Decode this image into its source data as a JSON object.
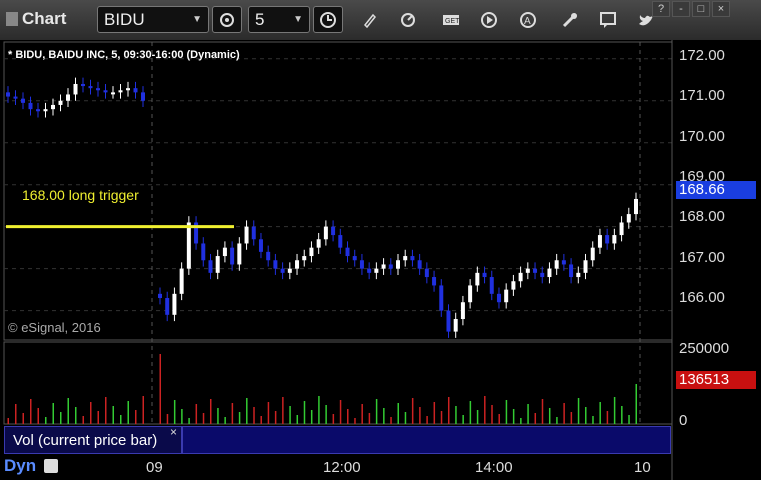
{
  "toolbar": {
    "title": "Chart",
    "symbol": "BIDU",
    "interval": "5",
    "icons": [
      "gear-icon",
      "clock-icon",
      "pencil-icon",
      "refresh-icon",
      "get-icon",
      "play-icon",
      "alert-icon",
      "tools-icon",
      "comment-icon",
      "twitter-icon"
    ],
    "window_buttons": [
      "?",
      "-",
      "□",
      "×"
    ]
  },
  "chart": {
    "symbol_info": "* BIDU, BAIDU INC, 5, 09:30-16:00 (Dynamic)",
    "annotation": "168.00 long trigger",
    "copyright": "© eSignal, 2016",
    "price_ticks": [
      "172.00",
      "171.00",
      "170.00",
      "169.00",
      "168.00",
      "167.00",
      "166.00"
    ],
    "last_price": "168.66",
    "volume_ticks": [
      "250000",
      "0"
    ],
    "last_volume": "136513",
    "volume_label": "Vol (current price bar)",
    "close_symbol": "×",
    "time_ticks": [
      "09",
      "12:00",
      "14:00",
      "10"
    ],
    "dyn_label": "Dyn",
    "colors": {
      "up": "#ffffff",
      "down": "#2030e0",
      "trigger": "#f0f030",
      "vol_up": "#33cc33",
      "vol_down": "#cc2222"
    }
  },
  "chart_data": {
    "type": "candlestick",
    "series": [
      {
        "name": "BIDU price",
        "values": [
          171.1,
          171.05,
          170.95,
          170.8,
          170.75,
          170.8,
          170.9,
          171.0,
          171.15,
          171.4,
          171.35,
          171.3,
          171.25,
          171.2,
          171.2,
          171.25,
          171.3,
          171.2,
          171.0,
          166.3,
          165.9,
          166.4,
          167.0,
          168.1,
          167.6,
          167.2,
          166.9,
          167.3,
          167.5,
          167.1,
          167.6,
          168.0,
          167.7,
          167.4,
          167.2,
          167.0,
          166.9,
          167.0,
          167.2,
          167.3,
          167.5,
          167.7,
          168.0,
          167.8,
          167.5,
          167.3,
          167.2,
          167.0,
          166.9,
          167.0,
          167.1,
          167.0,
          167.2,
          167.3,
          167.2,
          167.0,
          166.8,
          166.6,
          166.0,
          165.5,
          165.8,
          166.2,
          166.6,
          166.9,
          166.8,
          166.4,
          166.2,
          166.5,
          166.7,
          166.9,
          167.0,
          166.9,
          166.8,
          167.0,
          167.2,
          167.1,
          166.8,
          166.9,
          167.2,
          167.5,
          167.8,
          167.6,
          167.8,
          168.1,
          168.3,
          168.66
        ]
      }
    ],
    "annotation_level": 168.0,
    "ylim": [
      165.3,
      172.4
    ],
    "volume_ylim": [
      0,
      250000
    ]
  }
}
